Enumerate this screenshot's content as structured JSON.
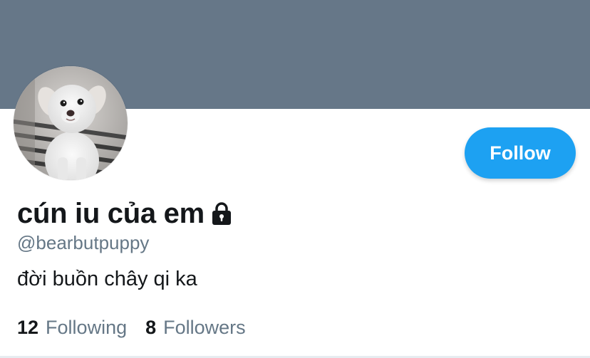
{
  "profile": {
    "display_name": "cún iu của em",
    "handle": "@bearbutpuppy",
    "bio": "đời buồn chây qi ka",
    "protected_icon": "lock-icon",
    "avatar_icon": "puppy-photo"
  },
  "actions": {
    "follow_label": "Follow"
  },
  "stats": {
    "following_count": "12",
    "following_label": "Following",
    "followers_count": "8",
    "followers_label": "Followers"
  },
  "colors": {
    "banner": "#667788",
    "accent": "#1da1f2",
    "text_primary": "#14171a",
    "text_secondary": "#657786"
  }
}
